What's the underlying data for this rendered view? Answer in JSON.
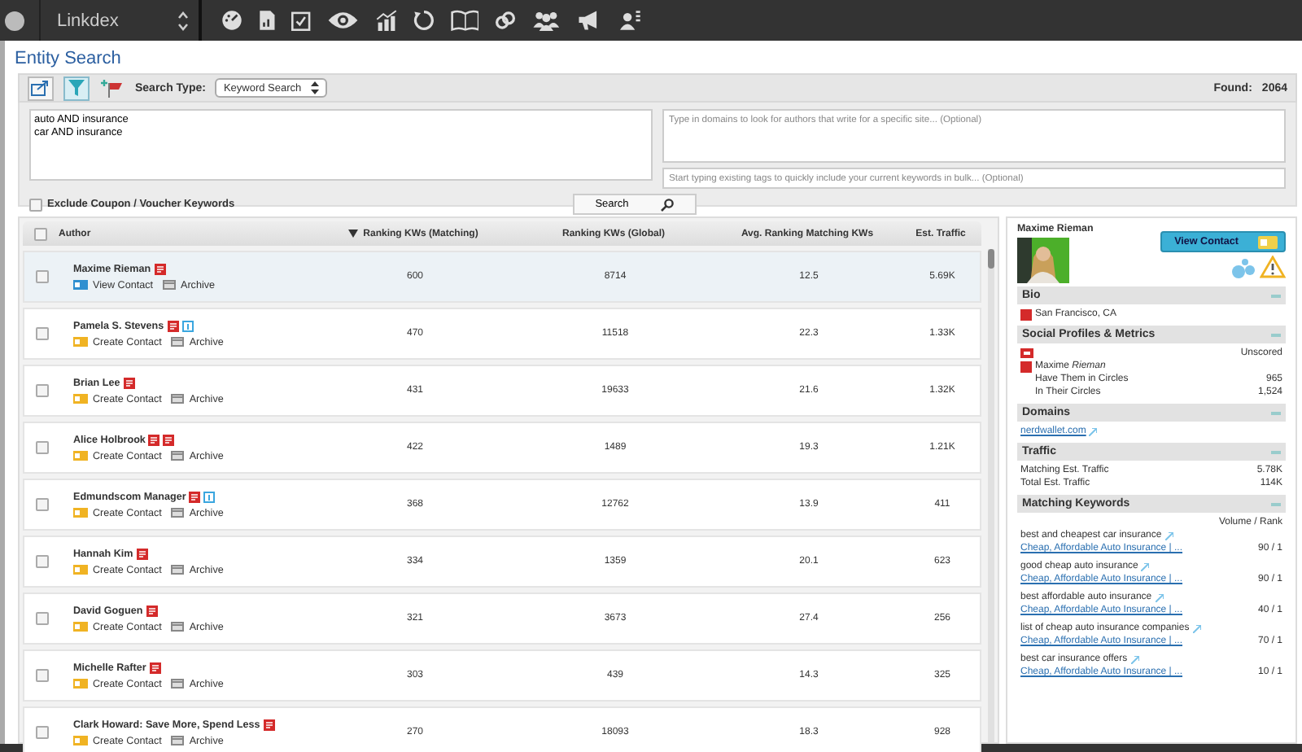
{
  "app_bar": {
    "app_name": "Linkdex"
  },
  "page_title": "Entity Search",
  "toolbar": {
    "search_type_label": "Search Type:",
    "search_type_value": "Keyword Search",
    "found_label": "Found:",
    "found_value": "2064"
  },
  "search": {
    "keywords_value": "auto AND insurance\ncar AND insurance",
    "domains_placeholder": "Type in domains to look for authors that write for a specific site... (Optional)",
    "tags_placeholder": "Start typing existing tags to quickly include your current keywords in bulk... (Optional)",
    "exclude": {
      "label": "Exclude Coupon / Voucher Keywords",
      "checked": false
    },
    "search_button": "Search"
  },
  "table": {
    "select_all_checked": false,
    "author_column": {
      "label": "Author"
    },
    "columns": [
      {
        "label": "Ranking KWs (Matching)",
        "sorted": true
      },
      {
        "label": "Ranking KWs (Global)",
        "sorted": false
      },
      {
        "label": "Avg. Ranking Matching KWs",
        "sorted": false
      },
      {
        "label": "Est. Traffic",
        "sorted": false
      }
    ],
    "rows": [
      {
        "author": "Maxime Rieman",
        "selected": true,
        "checked": false,
        "badges": [
          {
            "kind": "news"
          }
        ],
        "contact_action": {
          "kind": "view",
          "label": "View Contact"
        },
        "archive": "Archive",
        "cells": [
          "600",
          "8714",
          "12.5",
          "5.69K"
        ]
      },
      {
        "author": "Pamela S. Stevens",
        "selected": false,
        "checked": false,
        "badges": [
          {
            "kind": "news"
          },
          {
            "kind": "info"
          }
        ],
        "contact_action": {
          "kind": "create",
          "label": "Create Contact"
        },
        "archive": "Archive",
        "cells": [
          "470",
          "11518",
          "22.3",
          "1.33K"
        ]
      },
      {
        "author": "Brian Lee",
        "selected": false,
        "checked": false,
        "badges": [
          {
            "kind": "news"
          }
        ],
        "contact_action": {
          "kind": "create",
          "label": "Create Contact"
        },
        "archive": "Archive",
        "cells": [
          "431",
          "19633",
          "21.6",
          "1.32K"
        ]
      },
      {
        "author": "Alice Holbrook",
        "selected": false,
        "checked": false,
        "badges": [
          {
            "kind": "news"
          },
          {
            "kind": "news"
          }
        ],
        "contact_action": {
          "kind": "create",
          "label": "Create Contact"
        },
        "archive": "Archive",
        "cells": [
          "422",
          "1489",
          "19.3",
          "1.21K"
        ]
      },
      {
        "author": "Edmundscom Manager",
        "selected": false,
        "checked": false,
        "badges": [
          {
            "kind": "news"
          },
          {
            "kind": "info"
          }
        ],
        "contact_action": {
          "kind": "create",
          "label": "Create Contact"
        },
        "archive": "Archive",
        "cells": [
          "368",
          "12762",
          "13.9",
          "411"
        ]
      },
      {
        "author": "Hannah Kim",
        "selected": false,
        "checked": false,
        "badges": [
          {
            "kind": "news"
          }
        ],
        "contact_action": {
          "kind": "create",
          "label": "Create Contact"
        },
        "archive": "Archive",
        "cells": [
          "334",
          "1359",
          "20.1",
          "623"
        ]
      },
      {
        "author": "David Goguen",
        "selected": false,
        "checked": false,
        "badges": [
          {
            "kind": "news"
          }
        ],
        "contact_action": {
          "kind": "create",
          "label": "Create Contact"
        },
        "archive": "Archive",
        "cells": [
          "321",
          "3673",
          "27.4",
          "256"
        ]
      },
      {
        "author": "Michelle Rafter",
        "selected": false,
        "checked": false,
        "badges": [
          {
            "kind": "news"
          }
        ],
        "contact_action": {
          "kind": "create",
          "label": "Create Contact"
        },
        "archive": "Archive",
        "cells": [
          "303",
          "439",
          "14.3",
          "325"
        ]
      },
      {
        "author": "Clark Howard: Save More, Spend Less",
        "selected": false,
        "checked": false,
        "badges": [
          {
            "kind": "news"
          }
        ],
        "contact_action": {
          "kind": "create",
          "label": "Create Contact"
        },
        "archive": "Archive",
        "cells": [
          "270",
          "18093",
          "18.3",
          "928"
        ]
      }
    ]
  },
  "profile": {
    "name": "Maxime Rieman",
    "view_contact_button": "View Contact",
    "bio": {
      "title": "Bio",
      "location": "San Francisco, CA"
    },
    "social": {
      "title": "Social Profiles & Metrics",
      "score": "Unscored",
      "profile_name": "Maxime *Rieman*",
      "metrics": [
        {
          "label": "Have Them in Circles",
          "value": "965"
        },
        {
          "label": "In Their Circles",
          "value": "1,524"
        }
      ]
    },
    "domains": {
      "title": "Domains",
      "items": [
        "nerdwallet.com"
      ]
    },
    "traffic": {
      "title": "Traffic",
      "rows": [
        {
          "label": "Matching Est. Traffic",
          "value": "5.78K"
        },
        {
          "label": "Total Est. Traffic",
          "value": "114K"
        }
      ]
    },
    "keywords": {
      "title": "Matching Keywords",
      "column_label": "Volume / Rank",
      "items": [
        {
          "keyword": "best and cheapest car insurance",
          "link": "Cheap, Affordable Auto Insurance | ...",
          "value": "90 / 1"
        },
        {
          "keyword": "good cheap auto insurance",
          "link": "Cheap, Affordable Auto Insurance | ...",
          "value": "90 / 1"
        },
        {
          "keyword": "best affordable auto insurance",
          "link": "Cheap, Affordable Auto Insurance | ...",
          "value": "40 / 1"
        },
        {
          "keyword": "list of cheap auto insurance companies",
          "link": "Cheap, Affordable Auto Insurance | ...",
          "value": "70 / 1"
        },
        {
          "keyword": "best car insurance offers",
          "link": "Cheap, Affordable Auto Insurance | ...",
          "value": "10 / 1"
        }
      ]
    }
  }
}
